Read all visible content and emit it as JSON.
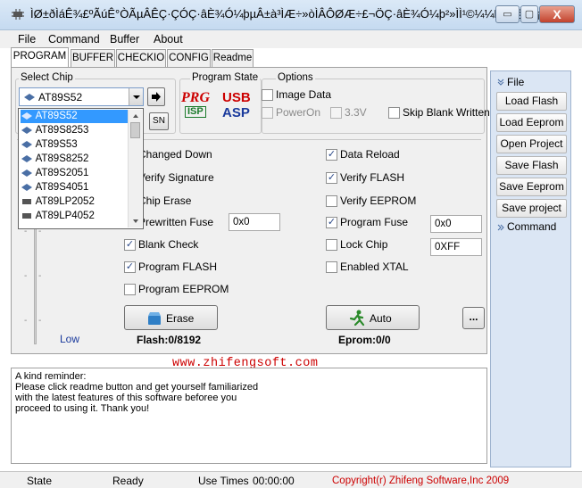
{
  "window": {
    "title": "ÌØ±ðÌáÊ¾£ºÃúÊ°ÒÃµÂÊÇ·ÇÓÇ·âÈ¾Ó¼þµÂ±à³ÌÆ÷»òÌÂÔØÆ÷£¬ÖÇ·âÈ¾Ó¼þ²»ÌÌ¹©¼¼ÊõÖ§³Ö¡£",
    "minimize": "▭",
    "maximize": "▢",
    "close": "X"
  },
  "menu": [
    "File",
    "Command",
    "Buffer",
    "About"
  ],
  "tabs": [
    "PROGRAM",
    "BUFFER",
    "CHECKIO",
    "CONFIG",
    "Readme"
  ],
  "select_chip": {
    "label": "Select Chip",
    "selected": "AT89S52",
    "dropdown_items": [
      "AT89S52",
      "AT89S8253",
      "AT89S53",
      "AT89S8252",
      "AT89S2051",
      "AT89S4051",
      "AT89LP2052",
      "AT89LP4052"
    ],
    "sn_label": "SN"
  },
  "program_state": {
    "label": "Program State",
    "prg": "PRG",
    "isp": "ISP",
    "usb": "USB",
    "asp": "ASP"
  },
  "options": {
    "label": "Options",
    "image_data": "Image Data",
    "power_on": "PowerOn",
    "v33": "3.3V",
    "skip_blank": "Skip Blank Written"
  },
  "left_checks": [
    {
      "label": "Changed Down",
      "checked": false
    },
    {
      "label": "Verify Signature",
      "checked": false
    },
    {
      "label": "Chip Erase",
      "checked": false
    },
    {
      "label": "Prewritten Fuse",
      "checked": false
    },
    {
      "label": "Blank Check",
      "checked": true
    },
    {
      "label": "Program FLASH",
      "checked": true
    },
    {
      "label": "Program EEPROM",
      "checked": false
    }
  ],
  "right_checks": [
    {
      "label": "Data Reload",
      "checked": true
    },
    {
      "label": "Verify FLASH",
      "checked": true
    },
    {
      "label": "Verify EEPROM",
      "checked": false
    },
    {
      "label": "Program Fuse",
      "checked": true
    },
    {
      "label": "Lock Chip",
      "checked": false
    },
    {
      "label": "Enabled XTAL",
      "checked": false
    }
  ],
  "fields": {
    "prewritten_fuse": "0x0",
    "program_fuse": "0x0",
    "lock_chip": "0XFF"
  },
  "speed_label": "Low",
  "buttons": {
    "erase": "Erase",
    "auto": "Auto",
    "more": "..."
  },
  "counters": {
    "flash": "Flash:0/8192",
    "eprom": "Eprom:0/0"
  },
  "website": "www.zhifengsoft.com",
  "reminder": "A kind reminder:\nPlease click readme button and get yourself familiarized\nwith the latest features of this software beforee you\nproceed to using it. Thank you!",
  "sidebar": {
    "file_header": "File",
    "items": [
      "Load Flash",
      "Load Eeprom",
      "Open Project",
      "Save Flash",
      "Save Eeprom",
      "Save project"
    ],
    "command_header": "Command"
  },
  "status": {
    "state_label": "State",
    "state_value": "Ready",
    "use_times_label": "Use Times",
    "use_times_value": "00:00:00",
    "copyright": "Copyright(r) Zhifeng Software,Inc 2009"
  },
  "colors": {
    "website": "#cc0000",
    "copyright": "#cc0000",
    "selection": "#3399ff",
    "prg": "#cc0000",
    "usb_blue": "#1a3a9c"
  }
}
